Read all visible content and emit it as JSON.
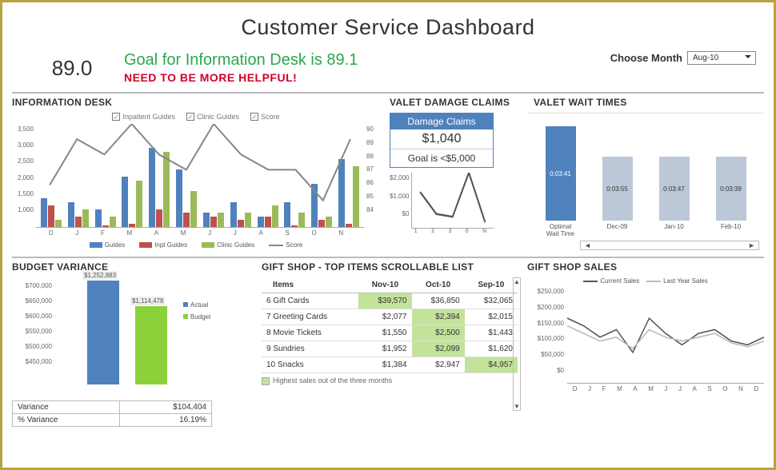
{
  "title": "Customer Service Dashboard",
  "top": {
    "score": "89.0",
    "goal_line": "Goal for Information Desk is 89.1",
    "need_line": "NEED TO BE MORE HELPFUL!",
    "choose_month_label": "Choose Month",
    "month_selected": "Aug-10"
  },
  "info_desk": {
    "title": "INFORMATION DESK",
    "checkboxes": [
      "Inpatient Guides",
      "Clinic Guides",
      "Score"
    ],
    "left_ticks": [
      "3,500",
      "3,000",
      "2,500",
      "2,000",
      "1,500",
      "1,000"
    ],
    "right_ticks": [
      "90",
      "89",
      "88",
      "87",
      "86",
      "85",
      "84"
    ],
    "legend": [
      "Guides",
      "Inpt Guides",
      "Clinic Guides",
      "Score"
    ]
  },
  "valet_claims": {
    "title": "VALET DAMAGE CLAIMS",
    "header": "Damage Claims",
    "value": "$1,040",
    "goal": "Goal is <$5,000",
    "y_ticks": [
      "$2,000",
      "$1,000",
      "$0"
    ],
    "x_ticks": [
      "1",
      "2",
      "3",
      "0",
      "N"
    ]
  },
  "valet_wait": {
    "title": "VALET WAIT TIMES",
    "bars": [
      {
        "cat": "Optimal Wait Time",
        "label": "0:03:41",
        "h": 118,
        "cls": "opt"
      },
      {
        "cat": "Dec-09",
        "label": "0:03:55",
        "h": 80,
        "cls": "oth"
      },
      {
        "cat": "Jan-10",
        "label": "0:03:47",
        "h": 80,
        "cls": "oth"
      },
      {
        "cat": "Feb-10",
        "label": "0:03:39",
        "h": 80,
        "cls": "oth"
      }
    ]
  },
  "budget": {
    "title": "BUDGET VARIANCE",
    "y_ticks": [
      "$700,000",
      "$650,000",
      "$600,000",
      "$550,000",
      "$500,000",
      "$450,000"
    ],
    "actual_label": "$1,252,883",
    "budget_label": "$1,114,478",
    "legend": [
      "Actual",
      "Budget"
    ],
    "rows": [
      [
        "Variance",
        "$104,404"
      ],
      [
        "% Variance",
        "16.19%"
      ]
    ]
  },
  "gift_shop": {
    "title": "GIFT SHOP - TOP ITEMS  SCROLLABLE LIST",
    "headers": [
      "Items",
      "Nov-10",
      "Oct-10",
      "Sep-10"
    ],
    "rows": [
      {
        "item": "6 Gift Cards",
        "vals": [
          "$39,570",
          "$36,850",
          "$32,065"
        ],
        "hl": 0
      },
      {
        "item": "7 Greeting Cards",
        "vals": [
          "$2,077",
          "$2,394",
          "$2,015"
        ],
        "hl": 1
      },
      {
        "item": "8 Movie Tickets",
        "vals": [
          "$1,550",
          "$2,500",
          "$1,443"
        ],
        "hl": 1
      },
      {
        "item": "9 Sundries",
        "vals": [
          "$1,952",
          "$2,099",
          "$1,620"
        ],
        "hl": 1
      },
      {
        "item": "10 Snacks",
        "vals": [
          "$1,384",
          "$2,947",
          "$4,957"
        ],
        "hl": 2
      }
    ],
    "note": "Highest sales out of the three months"
  },
  "sales": {
    "title": "GIFT SHOP SALES",
    "legend": [
      "Current Sales",
      "Last Year Sales"
    ],
    "y_ticks": [
      "$250,000",
      "$200,000",
      "$150,000",
      "$100,000",
      "$50,000",
      "$0"
    ]
  },
  "months12": [
    "D",
    "J",
    "F",
    "M",
    "A",
    "M",
    "J",
    "J",
    "A",
    "S",
    "O",
    "N"
  ],
  "months12b": [
    "D",
    "J",
    "F",
    "M",
    "A",
    "M",
    "J",
    "J",
    "A",
    "S",
    "O",
    "N",
    "D"
  ],
  "chart_data": {
    "info_desk_combo": {
      "type": "bar",
      "categories": [
        "D",
        "J",
        "F",
        "M",
        "A",
        "M",
        "J",
        "J",
        "A",
        "S",
        "O",
        "N"
      ],
      "series": [
        {
          "name": "Guides",
          "values": [
            1800,
            1700,
            1500,
            2400,
            3200,
            2600,
            1400,
            1700,
            1300,
            1700,
            2200,
            2900
          ]
        },
        {
          "name": "Inpt Guides",
          "values": [
            1600,
            1300,
            900,
            1100,
            1500,
            1400,
            1300,
            1200,
            1300,
            1000,
            1200,
            1100
          ]
        },
        {
          "name": "Clinic Guides",
          "values": [
            1200,
            1500,
            1300,
            2300,
            3100,
            2000,
            1400,
            1400,
            1600,
            1400,
            1300,
            2700
          ]
        }
      ],
      "line_series": {
        "name": "Score",
        "axis": "right",
        "values": [
          86,
          89,
          88,
          90,
          88,
          87,
          90,
          88,
          87,
          87,
          85,
          89
        ]
      },
      "ylim_left": [
        1000,
        3500
      ],
      "ylim_right": [
        84,
        90
      ]
    },
    "valet_damage_spark": {
      "type": "line",
      "x": [
        1,
        2,
        3,
        4,
        5
      ],
      "values": [
        1300,
        500,
        400,
        2000,
        200
      ],
      "ylim": [
        0,
        2000
      ]
    },
    "valet_wait_bars": {
      "type": "bar",
      "categories": [
        "Optimal Wait Time",
        "Dec-09",
        "Jan-10",
        "Feb-10"
      ],
      "values_seconds": [
        221,
        235,
        227,
        219
      ],
      "labels": [
        "0:03:41",
        "0:03:55",
        "0:03:47",
        "0:03:39"
      ]
    },
    "budget_variance": {
      "type": "bar",
      "categories": [
        "Actual",
        "Budget"
      ],
      "values": [
        1252883,
        1114478
      ],
      "ylim": [
        450000,
        700000
      ]
    },
    "gift_shop_sales": {
      "type": "line",
      "categories": [
        "D",
        "J",
        "F",
        "M",
        "A",
        "M",
        "J",
        "J",
        "A",
        "S",
        "O",
        "N",
        "D"
      ],
      "series": [
        {
          "name": "Current Sales",
          "values": [
            170000,
            150000,
            120000,
            140000,
            80000,
            170000,
            130000,
            100000,
            130000,
            140000,
            110000,
            100000,
            120000
          ]
        },
        {
          "name": "Last Year Sales",
          "values": [
            150000,
            130000,
            110000,
            120000,
            90000,
            140000,
            120000,
            110000,
            120000,
            130000,
            105000,
            95000,
            110000
          ]
        }
      ],
      "ylim": [
        0,
        250000
      ]
    }
  }
}
